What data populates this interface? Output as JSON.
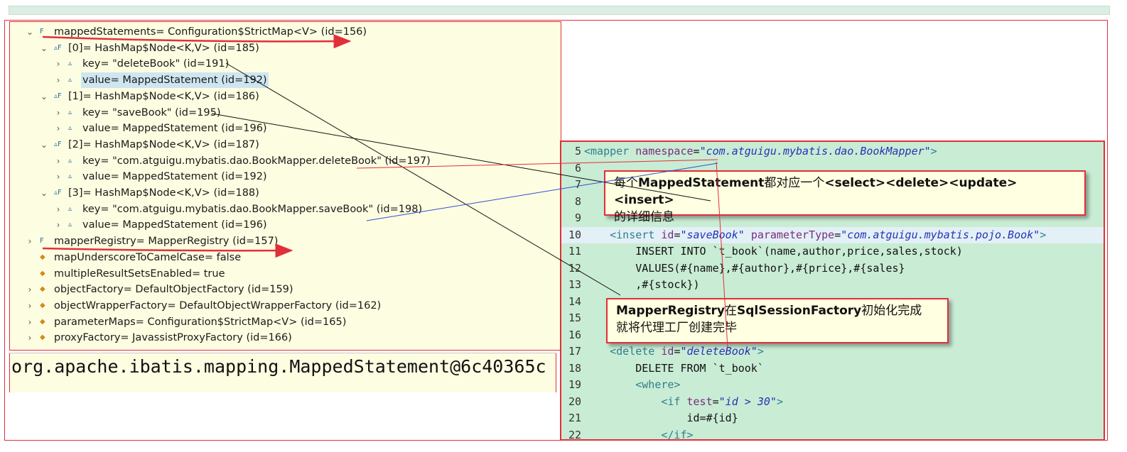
{
  "variables": [
    {
      "chev": "⌄",
      "icon": "F",
      "text": "mappedStatements= Configuration$StrictMap<V>  (id=156)"
    },
    {
      "chev": "⌄",
      "icon": "▵F",
      "text": "[0]= HashMap$Node<K,V>  (id=185)"
    },
    {
      "chev": "›",
      "icon": "▵",
      "text": "key= \"deleteBook\" (id=191)"
    },
    {
      "chev": "›",
      "icon": "▵",
      "text": "value= MappedStatement  (id=192)",
      "selected": true
    },
    {
      "chev": "⌄",
      "icon": "▵F",
      "text": "[1]= HashMap$Node<K,V>  (id=186)"
    },
    {
      "chev": "›",
      "icon": "▵",
      "text": "key= \"saveBook\" (id=195)"
    },
    {
      "chev": "›",
      "icon": "▵",
      "text": "value= MappedStatement  (id=196)"
    },
    {
      "chev": "⌄",
      "icon": "▵F",
      "text": "[2]= HashMap$Node<K,V>  (id=187)"
    },
    {
      "chev": "›",
      "icon": "▵",
      "text": "key= \"com.atguigu.mybatis.dao.BookMapper.deleteBook\" (id=197)"
    },
    {
      "chev": "›",
      "icon": "▵",
      "text": "value= MappedStatement  (id=192)"
    },
    {
      "chev": "⌄",
      "icon": "▵F",
      "text": "[3]= HashMap$Node<K,V>  (id=188)"
    },
    {
      "chev": "›",
      "icon": "▵",
      "text": "key= \"com.atguigu.mybatis.dao.BookMapper.saveBook\" (id=198)"
    },
    {
      "chev": "›",
      "icon": "▵",
      "text": "value= MappedStatement  (id=196)"
    },
    {
      "chev": "›",
      "icon": "F",
      "text": "mapperRegistry= MapperRegistry  (id=157)"
    },
    {
      "chev": "",
      "icon": "◆",
      "text": "mapUnderscoreToCamelCase= false"
    },
    {
      "chev": "",
      "icon": "◆",
      "text": "multipleResultSetsEnabled= true"
    },
    {
      "chev": "›",
      "icon": "◆",
      "text": "objectFactory= DefaultObjectFactory  (id=159)"
    },
    {
      "chev": "›",
      "icon": "◆",
      "text": "objectWrapperFactory= DefaultObjectWrapperFactory  (id=162)"
    },
    {
      "chev": "›",
      "icon": "◆",
      "text": "parameterMaps= Configuration$StrictMap<V>  (id=165)"
    },
    {
      "chev": "›",
      "icon": "◆",
      "text": "proxyFactory= JavassistProxyFactory  (id=166)"
    }
  ],
  "detail_value": "org.apache.ibatis.mapping.MappedStatement@6c40365c",
  "code_lines": [
    {
      "n": "5",
      "parts": [
        [
          "tag",
          "<mapper "
        ],
        [
          "attr",
          "namespace"
        ],
        [
          "plain",
          "="
        ],
        [
          "val",
          "\"com.atguigu.mybatis.dao.BookMapper\""
        ],
        [
          "tag",
          ">"
        ]
      ]
    },
    {
      "n": "6",
      "parts": []
    },
    {
      "n": "7",
      "parts": []
    },
    {
      "n": "8",
      "parts": []
    },
    {
      "n": "9",
      "parts": []
    },
    {
      "n": "10",
      "hl": true,
      "parts": [
        [
          "plain",
          "    "
        ],
        [
          "tag",
          "<insert "
        ],
        [
          "attr",
          "id"
        ],
        [
          "plain",
          "="
        ],
        [
          "val",
          "\"saveBook\""
        ],
        [
          "plain",
          " "
        ],
        [
          "attr",
          "parameterType"
        ],
        [
          "plain",
          "="
        ],
        [
          "val",
          "\"com.atguigu.mybatis.pojo.Book\""
        ],
        [
          "tag",
          ">"
        ]
      ]
    },
    {
      "n": "11",
      "parts": [
        [
          "plain",
          "        INSERT INTO `t_book`(name,author,price,sales,stock)"
        ]
      ]
    },
    {
      "n": "12",
      "parts": [
        [
          "plain",
          "        VALUES(#{name},#{author},#{price},#{sales}"
        ]
      ]
    },
    {
      "n": "13",
      "parts": [
        [
          "plain",
          "        ,#{stock})"
        ]
      ]
    },
    {
      "n": "14",
      "parts": []
    },
    {
      "n": "15",
      "parts": []
    },
    {
      "n": "16",
      "parts": []
    },
    {
      "n": "17",
      "parts": [
        [
          "plain",
          "    "
        ],
        [
          "tag",
          "<delete "
        ],
        [
          "attr",
          "id"
        ],
        [
          "plain",
          "="
        ],
        [
          "val",
          "\"deleteBook\""
        ],
        [
          "tag",
          ">"
        ]
      ]
    },
    {
      "n": "18",
      "parts": [
        [
          "plain",
          "        DELETE FROM `t_book`"
        ]
      ]
    },
    {
      "n": "19",
      "parts": [
        [
          "plain",
          "        "
        ],
        [
          "tag",
          "<where>"
        ]
      ]
    },
    {
      "n": "20",
      "parts": [
        [
          "plain",
          "            "
        ],
        [
          "tag",
          "<if "
        ],
        [
          "attr",
          "test"
        ],
        [
          "plain",
          "="
        ],
        [
          "val",
          "\"id > 30\""
        ],
        [
          "tag",
          ">"
        ]
      ]
    },
    {
      "n": "21",
      "parts": [
        [
          "plain",
          "                id=#{id}"
        ]
      ]
    },
    {
      "n": "22",
      "parts": [
        [
          "plain",
          "            "
        ],
        [
          "tag",
          "</if>"
        ]
      ]
    }
  ],
  "callouts": {
    "mapped": {
      "bold1": "MappedStatement",
      "pre": "每个",
      "mid": "都对应一个",
      "bold2": "<select><delete><update><insert>",
      "line2": "的详细信息"
    },
    "registry": {
      "bold1": "MapperRegistry",
      "mid": "在",
      "bold2": "SqlSessionFactory",
      "post": "初始化完成",
      "line2": "就将代理工厂创建完毕"
    }
  },
  "colors": {
    "accent_red": "#e0303a",
    "editor_bg": "#c9ecd4",
    "panel_bg": "#fdfde1"
  }
}
